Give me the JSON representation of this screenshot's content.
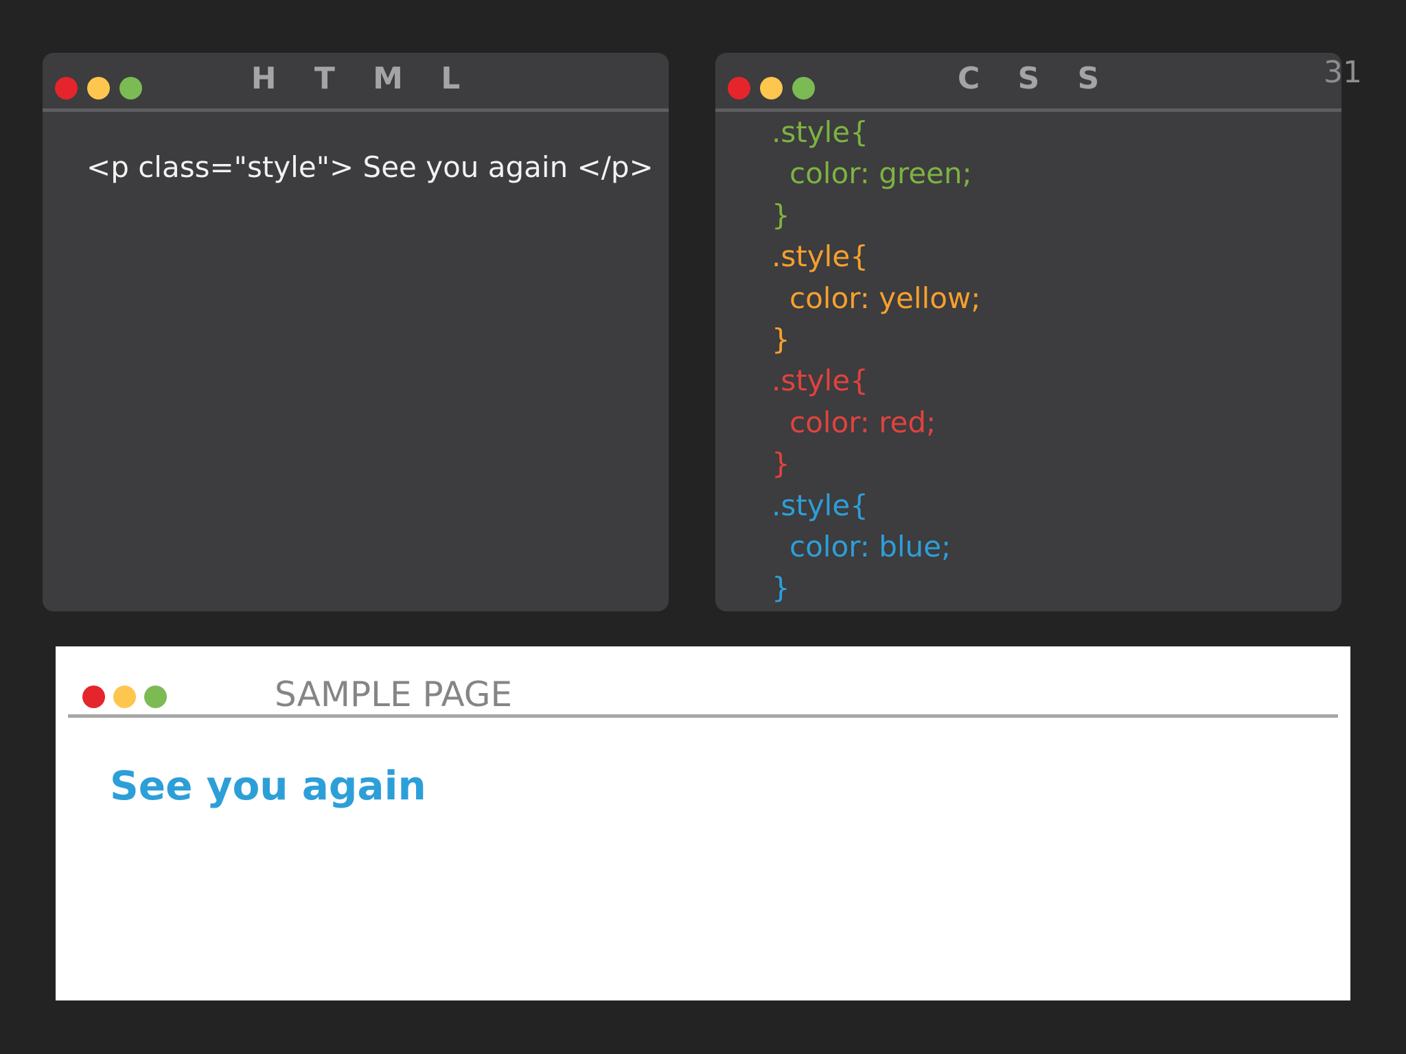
{
  "html_editor": {
    "title": "H T M L",
    "code": "<p class=\"style\"> See you again </p>"
  },
  "css_editor": {
    "title": "C S S",
    "rules": [
      {
        "selector": ".style{",
        "declaration": "color: green;",
        "close": "}",
        "color": "#7cb342"
      },
      {
        "selector": ".style{",
        "declaration": "color: yellow;",
        "close": "}",
        "color": "#f6a02e"
      },
      {
        "selector": ".style{",
        "declaration": "color: red;",
        "close": "}",
        "color": "#e0433e"
      },
      {
        "selector": ".style{",
        "declaration": "color: blue;",
        "close": "}",
        "color": "#2d9fd8"
      }
    ]
  },
  "slide_number": "31",
  "browser": {
    "title": "SAMPLE PAGE",
    "rendered_text": "See you again",
    "rendered_color": "#2d9fd8"
  },
  "colors": {
    "close": "#e5242c",
    "minimize": "#fec64e",
    "maximize": "#7cbb54",
    "background": "#232324",
    "editor": "#3d3c3e"
  }
}
